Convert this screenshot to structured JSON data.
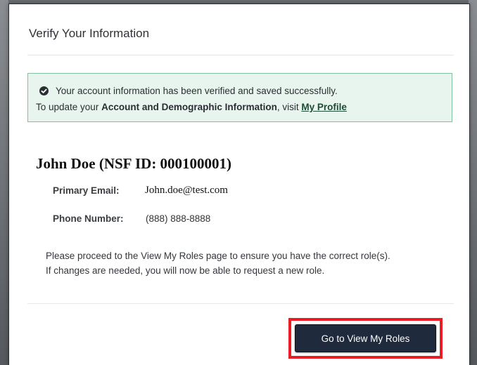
{
  "modal": {
    "title": "Verify Your Information"
  },
  "alert": {
    "line1": "Your account information has been verified and saved successfully.",
    "line2_prefix": "To update your ",
    "line2_bold": "Account and Demographic Information",
    "line2_mid": ", visit ",
    "line2_link": "My Profile",
    "icon": "check-circle-icon",
    "colors": {
      "background": "#e7f5ee",
      "border": "#7fc3a0"
    }
  },
  "user": {
    "heading": "John Doe (NSF ID: 000100001)",
    "email_label": "Primary Email:",
    "email_value": "John.doe@test.com",
    "phone_label": "Phone Number:",
    "phone_value": "(888) 888-8888"
  },
  "instructions": {
    "line1": "Please proceed to the View My Roles page to ensure you have the correct role(s).",
    "line2": "If changes are needed, you will now be able to request a new role."
  },
  "footer": {
    "button_label": "Go to View My Roles",
    "button_color": "#1f2a3c",
    "highlight_color": "#ea1d25"
  }
}
